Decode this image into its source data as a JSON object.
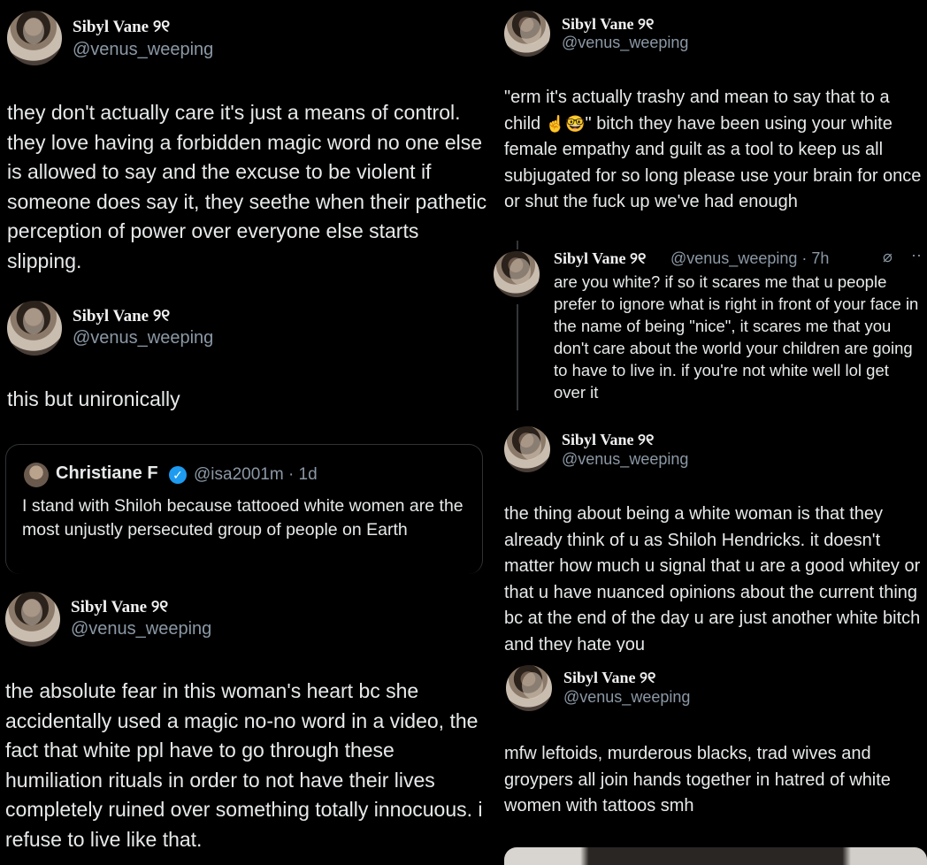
{
  "left": {
    "tweets": [
      {
        "name": "Sibyl Vane ୨୧",
        "handle": "@venus_weeping",
        "text": "they don't actually care it's just a means of control. they love having a forbidden magic word no one else is allowed to say and the excuse to be violent if someone does say it, they seethe when their pathetic perception of power over everyone else starts slipping."
      },
      {
        "name": "Sibyl Vane ୨୧",
        "handle": "@venus_weeping",
        "text": "this but unironically",
        "quote": {
          "name": "Christiane F",
          "verified": "✓",
          "handle_time": "@isa2001m · 1d",
          "text": "I stand with Shiloh because tattooed white women are the most unjustly persecuted group of people on Earth"
        }
      },
      {
        "name": "Sibyl Vane ୨୧",
        "handle": "@venus_weeping",
        "text": "the absolute fear in this woman's heart bc she accidentally used a magic no-no word in a video, the fact that white ppl have to go through these humiliation rituals in order to not have their lives completely ruined over something totally innocuous. i refuse to live like that."
      }
    ]
  },
  "right": {
    "tweets": [
      {
        "name": "Sibyl Vane ୨୧",
        "handle": "@venus_weeping",
        "text_a": "\"erm it's actually trashy and mean to say that to a child ",
        "emoji": "☝️🤓",
        "text_b": "\" bitch they have been using your white female empathy and guilt as a tool to keep us all subjugated for so long please use your brain for once or shut the fuck up we've had enough"
      },
      {
        "reply_name": "Sibyl Vane ୨୧",
        "reply_meta": "@venus_weeping · 7h",
        "grok_icon": "⌀",
        "more_icon": "··",
        "reply_text": "are you white? if so it scares me that u people prefer to ignore what is right in front of your face in the name of being \"nice\", it scares me that you don't care about the world your children are going to have to live in. if you're not white well lol get over it"
      },
      {
        "name": "Sibyl Vane ୨୧",
        "handle": "@venus_weeping",
        "text": "the thing about being a white woman is that they already think of u as Shiloh Hendricks. it doesn't matter how much u signal that u are a good whitey or that u have nuanced opinions about the current thing bc at the end of the day u are just another white bitch and they hate you"
      },
      {
        "name": "Sibyl Vane ୨୧",
        "handle": "@venus_weeping",
        "text": "mfw leftoids, murderous blacks, trad wives and groypers all join hands together in hatred of white women with tattoos smh"
      }
    ]
  }
}
